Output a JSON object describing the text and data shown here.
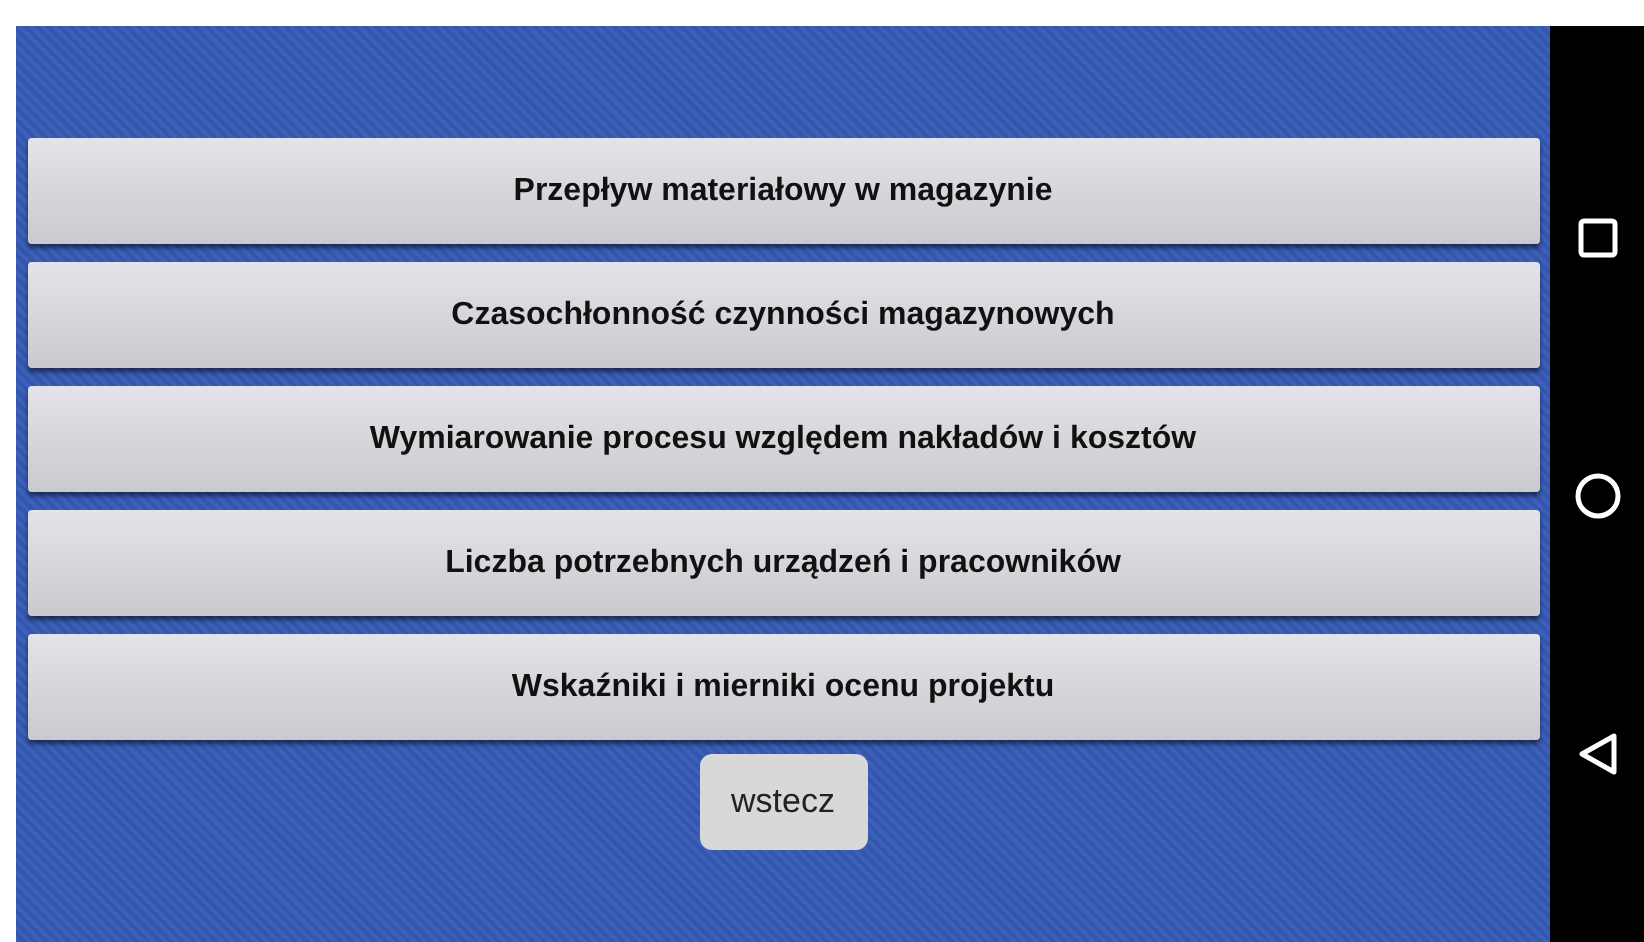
{
  "menu_buttons": [
    {
      "label": "Przepływ materiałowy w magazynie"
    },
    {
      "label": "Czasochłonność czynności magazynowych"
    },
    {
      "label": "Wymiarowanie procesu względem nakładów i kosztów"
    },
    {
      "label": "Liczba potrzebnych urządzeń i pracowników"
    },
    {
      "label": "Wskaźniki i mierniki ocenu projektu"
    }
  ],
  "back_button": {
    "label": "wstecz"
  }
}
